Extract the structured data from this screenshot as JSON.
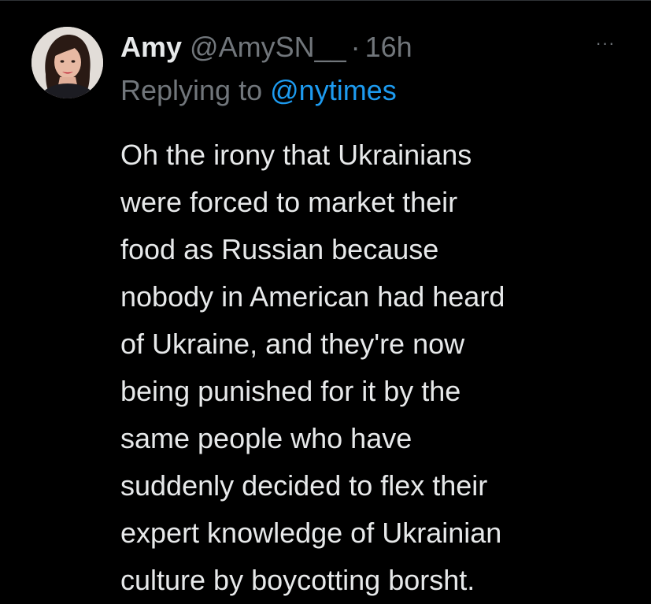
{
  "tweet": {
    "display_name": "Amy",
    "handle": "@AmySN__",
    "separator": "·",
    "time": "16h",
    "more_icon": "ellipsis-icon",
    "more_label": "···",
    "reply_prefix": "Replying to",
    "reply_to": "@nytimes",
    "text_lines": [
      "Oh the irony that Ukrainians",
      "were forced to market their",
      "food as Russian because",
      "nobody in American had heard",
      "of Ukraine, and they're now",
      "being punished for it by the",
      "same people who have",
      "suddenly decided to flex their",
      "expert knowledge of Ukrainian",
      "culture by boycotting borsht."
    ]
  },
  "colors": {
    "background": "#000000",
    "primary_text": "#e7e9ea",
    "secondary_text": "#71767b",
    "link": "#1d9bf0"
  }
}
